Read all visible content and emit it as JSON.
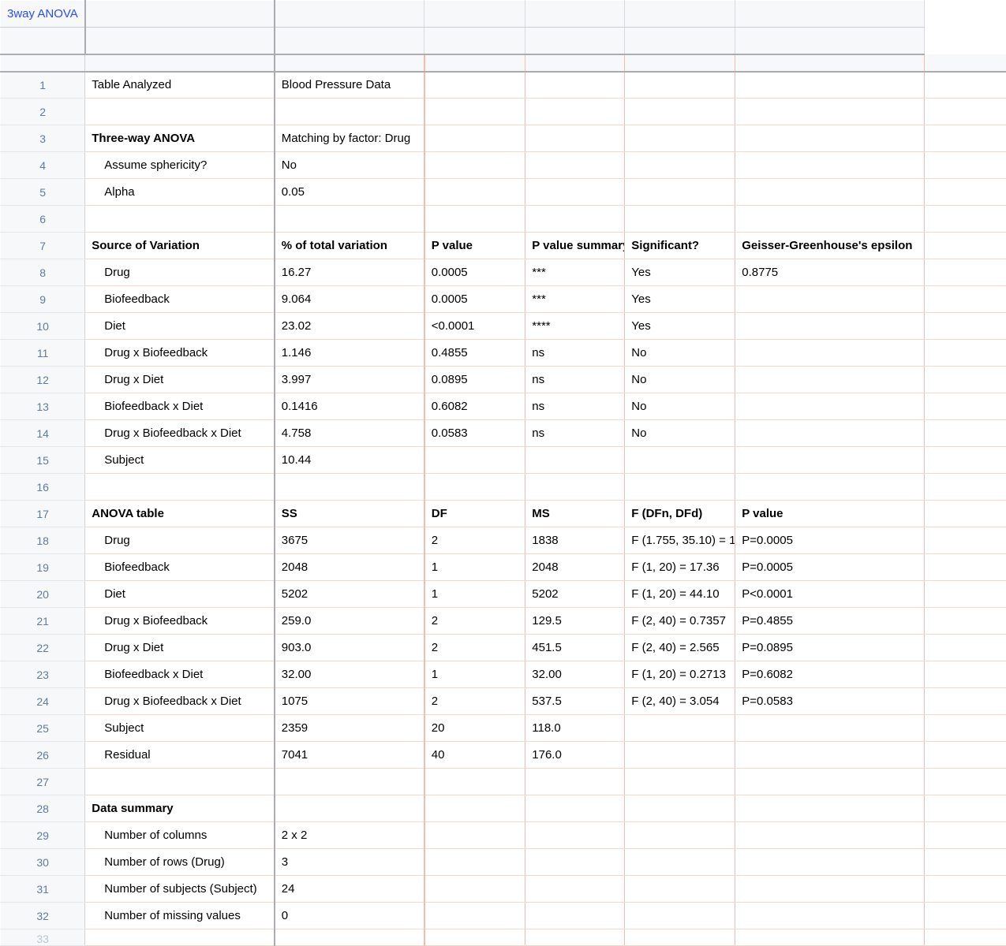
{
  "tab_title": "3way ANOVA",
  "rows": [
    {
      "n": "1",
      "a": "Table Analyzed",
      "b": "Blood Pressure Data",
      "c": "",
      "d": "",
      "e": "",
      "f": "",
      "g": ""
    },
    {
      "n": "2",
      "a": "",
      "b": "",
      "c": "",
      "d": "",
      "e": "",
      "f": "",
      "g": ""
    },
    {
      "n": "3",
      "a": "Three-way ANOVA",
      "a_bold": true,
      "b": "Matching by factor: Drug",
      "c": "",
      "d": "",
      "e": "",
      "f": "",
      "g": ""
    },
    {
      "n": "4",
      "a": "Assume sphericity?",
      "a_indent": true,
      "b": "No",
      "c": "",
      "d": "",
      "e": "",
      "f": "",
      "g": ""
    },
    {
      "n": "5",
      "a": "Alpha",
      "a_indent": true,
      "b": "0.05",
      "c": "",
      "d": "",
      "e": "",
      "f": "",
      "g": ""
    },
    {
      "n": "6",
      "a": "",
      "b": "",
      "c": "",
      "d": "",
      "e": "",
      "f": "",
      "g": ""
    },
    {
      "n": "7",
      "a": "Source of Variation",
      "a_bold": true,
      "b": "% of total variation",
      "b_bold": true,
      "c": "P value",
      "c_bold": true,
      "d": "P value summary",
      "d_bold": true,
      "e": "Significant?",
      "e_bold": true,
      "f": "Geisser-Greenhouse's epsilon",
      "f_bold": true,
      "g": ""
    },
    {
      "n": "8",
      "a": "Drug",
      "a_indent": true,
      "b": "16.27",
      "c": "0.0005",
      "d": "***",
      "e": "Yes",
      "f": "0.8775",
      "g": ""
    },
    {
      "n": "9",
      "a": "Biofeedback",
      "a_indent": true,
      "b": "9.064",
      "c": "0.0005",
      "d": "***",
      "e": "Yes",
      "f": "",
      "g": ""
    },
    {
      "n": "10",
      "a": "Diet",
      "a_indent": true,
      "b": "23.02",
      "c": "<0.0001",
      "d": "****",
      "e": "Yes",
      "f": "",
      "g": ""
    },
    {
      "n": "11",
      "a": "Drug x Biofeedback",
      "a_indent": true,
      "b": "1.146",
      "c": "0.4855",
      "d": "ns",
      "e": "No",
      "f": "",
      "g": ""
    },
    {
      "n": "12",
      "a": "Drug x Diet",
      "a_indent": true,
      "b": "3.997",
      "c": "0.0895",
      "d": "ns",
      "e": "No",
      "f": "",
      "g": ""
    },
    {
      "n": "13",
      "a": "Biofeedback x Diet",
      "a_indent": true,
      "b": "0.1416",
      "c": "0.6082",
      "d": "ns",
      "e": "No",
      "f": "",
      "g": ""
    },
    {
      "n": "14",
      "a": "Drug x Biofeedback x Diet",
      "a_indent": true,
      "b": "4.758",
      "c": "0.0583",
      "d": "ns",
      "e": "No",
      "f": "",
      "g": ""
    },
    {
      "n": "15",
      "a": "Subject",
      "a_indent": true,
      "b": "10.44",
      "c": "",
      "d": "",
      "e": "",
      "f": "",
      "g": ""
    },
    {
      "n": "16",
      "a": "",
      "b": "",
      "c": "",
      "d": "",
      "e": "",
      "f": "",
      "g": ""
    },
    {
      "n": "17",
      "a": "ANOVA table",
      "a_bold": true,
      "b": "SS",
      "b_bold": true,
      "c": "DF",
      "c_bold": true,
      "d": "MS",
      "d_bold": true,
      "e": "F (DFn, DFd)",
      "e_bold": true,
      "f": "P value",
      "f_bold": true,
      "g": ""
    },
    {
      "n": "18",
      "a": "Drug",
      "a_indent": true,
      "b": "3675",
      "c": "2",
      "d": "1838",
      "e": "F (1.755, 35.10) = 1",
      "f": "P=0.0005",
      "g": ""
    },
    {
      "n": "19",
      "a": "Biofeedback",
      "a_indent": true,
      "b": "2048",
      "c": "1",
      "d": "2048",
      "e": "F (1, 20) = 17.36",
      "f": "P=0.0005",
      "g": ""
    },
    {
      "n": "20",
      "a": "Diet",
      "a_indent": true,
      "b": "5202",
      "c": "1",
      "d": "5202",
      "e": "F (1, 20) = 44.10",
      "f": "P<0.0001",
      "g": ""
    },
    {
      "n": "21",
      "a": "Drug x Biofeedback",
      "a_indent": true,
      "b": "259.0",
      "c": "2",
      "d": "129.5",
      "e": "F (2, 40) = 0.7357",
      "f": "P=0.4855",
      "g": ""
    },
    {
      "n": "22",
      "a": "Drug x Diet",
      "a_indent": true,
      "b": "903.0",
      "c": "2",
      "d": "451.5",
      "e": "F (2, 40) = 2.565",
      "f": "P=0.0895",
      "g": ""
    },
    {
      "n": "23",
      "a": "Biofeedback x Diet",
      "a_indent": true,
      "b": "32.00",
      "c": "1",
      "d": "32.00",
      "e": "F (1, 20) = 0.2713",
      "f": "P=0.6082",
      "g": ""
    },
    {
      "n": "24",
      "a": "Drug x Biofeedback x Diet",
      "a_indent": true,
      "b": "1075",
      "c": "2",
      "d": "537.5",
      "e": "F (2, 40) = 3.054",
      "f": "P=0.0583",
      "g": ""
    },
    {
      "n": "25",
      "a": "Subject",
      "a_indent": true,
      "b": "2359",
      "c": "20",
      "d": "118.0",
      "e": "",
      "f": "",
      "g": ""
    },
    {
      "n": "26",
      "a": "Residual",
      "a_indent": true,
      "b": "7041",
      "c": "40",
      "d": "176.0",
      "e": "",
      "f": "",
      "g": ""
    },
    {
      "n": "27",
      "a": "",
      "b": "",
      "c": "",
      "d": "",
      "e": "",
      "f": "",
      "g": ""
    },
    {
      "n": "28",
      "a": "Data summary",
      "a_bold": true,
      "b": "",
      "c": "",
      "d": "",
      "e": "",
      "f": "",
      "g": ""
    },
    {
      "n": "29",
      "a": "Number of columns",
      "a_indent": true,
      "b": "2 x 2",
      "c": "",
      "d": "",
      "e": "",
      "f": "",
      "g": ""
    },
    {
      "n": "30",
      "a": "Number of rows (Drug)",
      "a_indent": true,
      "b": "3",
      "c": "",
      "d": "",
      "e": "",
      "f": "",
      "g": ""
    },
    {
      "n": "31",
      "a": "Number of subjects (Subject)",
      "a_indent": true,
      "b": "24",
      "c": "",
      "d": "",
      "e": "",
      "f": "",
      "g": ""
    },
    {
      "n": "32",
      "a": "Number of missing values",
      "a_indent": true,
      "b": "0",
      "c": "",
      "d": "",
      "e": "",
      "f": "",
      "g": ""
    },
    {
      "n": "33",
      "a": "",
      "b": "",
      "c": "",
      "d": "",
      "e": "",
      "f": "",
      "g": "",
      "partial": true
    }
  ]
}
